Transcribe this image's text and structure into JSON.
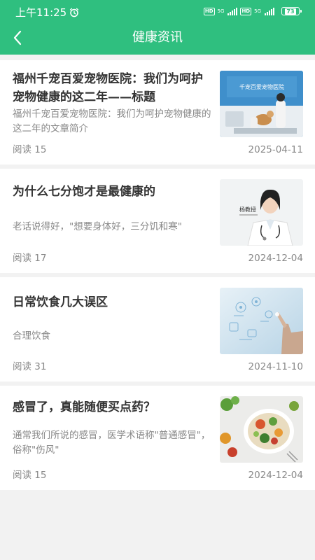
{
  "status_bar": {
    "time": "上午11:25",
    "network_left": "HD",
    "signal_left": "5G",
    "network_right": "HD",
    "signal_right": "5G",
    "battery": "73"
  },
  "nav": {
    "title": "健康资讯"
  },
  "articles": [
    {
      "title": "福州千宠百爱宠物医院：我们为呵护宠物健康的这二年——标题",
      "summary": "福州千宠百爱宠物医院：我们为呵护宠物健康的这二年的文章简介",
      "read": "阅读 15",
      "date": "2025-04-11",
      "thumb_text": "千宠百爱宠物医院",
      "thumb_icon": "pet-clinic-photo"
    },
    {
      "title": "为什么七分饱才是最健康的",
      "summary": "老话说得好，\"想要身体好，三分饥和寒\"",
      "read": "阅读 17",
      "date": "2024-12-04",
      "thumb_text": "杨教授",
      "thumb_icon": "doctor-photo"
    },
    {
      "title": "日常饮食几大误区",
      "summary": "合理饮食",
      "read": "阅读 31",
      "date": "2024-11-10",
      "thumb_icon": "digital-health-photo"
    },
    {
      "title": "感冒了，真能随便买点药？",
      "summary": "通常我们所说的感冒，医学术语称\"普通感冒\"，俗称\"伤风\"",
      "read": "阅读 15",
      "date": "2024-12-04",
      "thumb_icon": "salad-bowl-photo"
    }
  ],
  "colors": {
    "header": "#2fbf7f",
    "background": "#f2f2f2",
    "title_text": "#333333",
    "muted_text": "#888888"
  }
}
